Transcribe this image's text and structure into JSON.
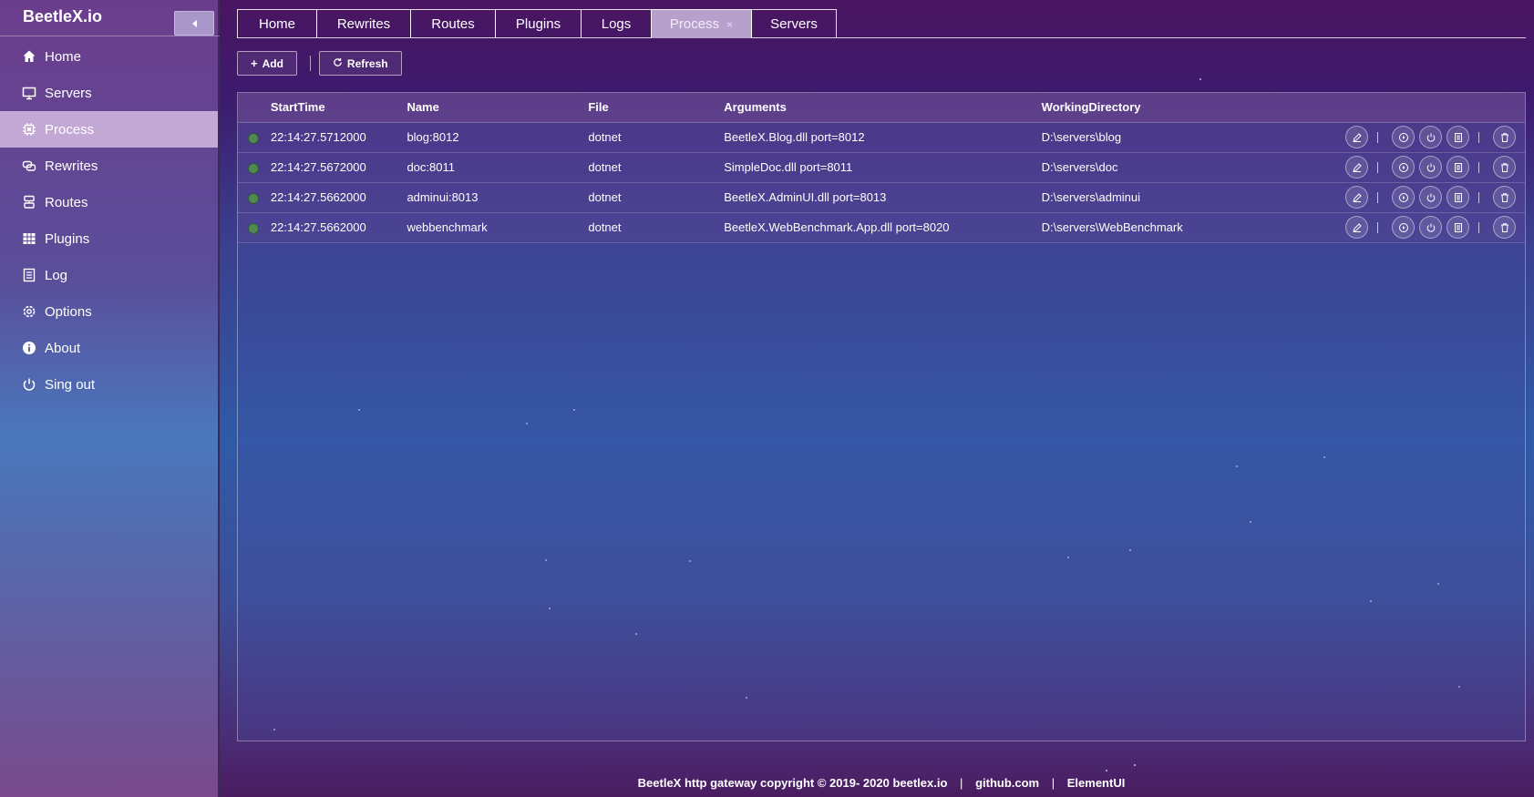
{
  "brand": {
    "title": "BeetleX.io"
  },
  "sidebar": {
    "items": [
      {
        "label": "Home",
        "icon": "home-icon"
      },
      {
        "label": "Servers",
        "icon": "monitor-icon"
      },
      {
        "label": "Process",
        "icon": "cpu-icon",
        "active": true
      },
      {
        "label": "Rewrites",
        "icon": "link-icon"
      },
      {
        "label": "Routes",
        "icon": "server-icon"
      },
      {
        "label": "Plugins",
        "icon": "grid-icon"
      },
      {
        "label": "Log",
        "icon": "document-icon"
      },
      {
        "label": "Options",
        "icon": "gear-icon"
      },
      {
        "label": "About",
        "icon": "info-icon"
      },
      {
        "label": "Sing out",
        "icon": "power-icon"
      }
    ]
  },
  "tabs": [
    {
      "label": "Home"
    },
    {
      "label": "Rewrites"
    },
    {
      "label": "Routes"
    },
    {
      "label": "Plugins"
    },
    {
      "label": "Logs"
    },
    {
      "label": "Process",
      "active": true,
      "close": "×"
    },
    {
      "label": "Servers"
    }
  ],
  "toolbar": {
    "add_label": "Add",
    "refresh_label": "Refresh"
  },
  "table": {
    "columns": [
      "StartTime",
      "Name",
      "File",
      "Arguments",
      "WorkingDirectory"
    ],
    "rows": [
      {
        "start": "22:14:27.5712000",
        "name": "blog:8012",
        "file": "dotnet",
        "args": "BeetleX.Blog.dll port=8012",
        "wd": "D:\\servers\\blog"
      },
      {
        "start": "22:14:27.5672000",
        "name": "doc:8011",
        "file": "dotnet",
        "args": "SimpleDoc.dll port=8011",
        "wd": "D:\\servers\\doc"
      },
      {
        "start": "22:14:27.5662000",
        "name": "adminui:8013",
        "file": "dotnet",
        "args": "BeetleX.AdminUI.dll port=8013",
        "wd": "D:\\servers\\adminui"
      },
      {
        "start": "22:14:27.5662000",
        "name": "webbenchmark",
        "file": "dotnet",
        "args": "BeetleX.WebBenchmark.App.dll port=8020",
        "wd": "D:\\servers\\WebBenchmark"
      }
    ]
  },
  "footer": {
    "copyright": "BeetleX http gateway copyright © 2019- 2020 beetlex.io",
    "link1": "github.com",
    "link2": "ElementUI",
    "sep": "|"
  },
  "colors": {
    "status_running": "#4f8a52",
    "active_menu": "#c3a8d6",
    "active_tab": "#b8a0cc"
  }
}
